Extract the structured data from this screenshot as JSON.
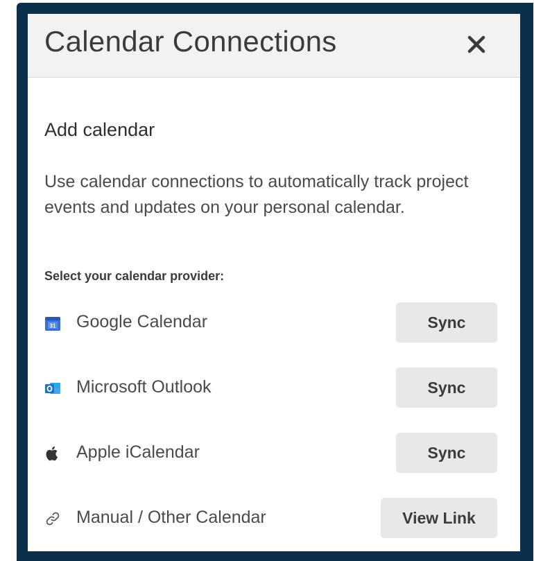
{
  "modal": {
    "title": "Calendar Connections",
    "close_icon": "close-icon"
  },
  "content": {
    "heading": "Add calendar",
    "description": "Use calendar connections to automatically track project events and updates on your personal calendar.",
    "select_label": "Select your calendar provider:"
  },
  "providers": [
    {
      "name": "Google Calendar",
      "icon": "google-calendar-icon",
      "button": "Sync"
    },
    {
      "name": "Microsoft Outlook",
      "icon": "outlook-icon",
      "button": "Sync"
    },
    {
      "name": "Apple iCalendar",
      "icon": "apple-icon",
      "button": "Sync"
    },
    {
      "name": "Manual / Other Calendar",
      "icon": "link-icon",
      "button": "View Link"
    }
  ],
  "colors": {
    "frame": "#0b2e4a",
    "header_bg": "#f2f2f2",
    "button_bg": "#e8e8e8",
    "google_blue": "#3b6fd8",
    "outlook_blue": "#1a73c9"
  }
}
